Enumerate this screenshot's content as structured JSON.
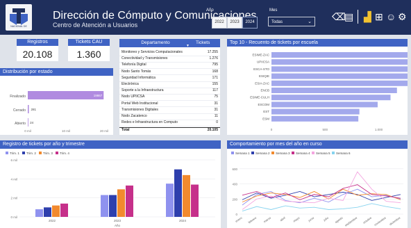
{
  "header": {
    "logo_text": "NACIONAL DE",
    "title": "Dirección de Cómputo y Comunicaciones",
    "subtitle": "Centro de Atención a Usuarios",
    "year_label": "Año",
    "years": [
      "2022",
      "2023",
      "2024"
    ],
    "selected_year": "2024",
    "month_label": "Mes",
    "month_value": "Todas",
    "icons": [
      "eraser-icon",
      "bookmark-icon",
      "bar-chart-icon",
      "sitemap-icon",
      "users-icon",
      "settings-icon"
    ]
  },
  "kpis": [
    {
      "label": "Registros",
      "value": "20.108"
    },
    {
      "label": "Tickets CAU",
      "value": "1.360"
    }
  ],
  "status_chart": {
    "title": "Distribución por estado",
    "categories": [
      "Finalizado",
      "Cerrado",
      "Abierto"
    ],
    "values": [
      19867,
      281,
      24
    ],
    "labels": [
      "19867",
      "281",
      "24"
    ],
    "x_ticks": [
      "0 mil",
      "10 mil",
      "20 mil"
    ],
    "color": "#b08be0"
  },
  "dept_table": {
    "col1": "Departamento",
    "col2": "Tickets",
    "rows": [
      [
        "Monitoreo y Servicios Computacionales",
        "17.255"
      ],
      [
        "Conectividad y Transmisiones",
        "1.276"
      ],
      [
        "Telefonía Digital",
        "795"
      ],
      [
        "Nodo Santo Tomás",
        "168"
      ],
      [
        "Seguridad Informática",
        "171"
      ],
      [
        "Electrónica",
        "155"
      ],
      [
        "Soporte a la Infraestructura",
        "117"
      ],
      [
        "Nodo UPIICSA",
        "75"
      ],
      [
        "Portal Web Institucional",
        "31"
      ],
      [
        "Transmisiones Digitales",
        "31"
      ],
      [
        "Nodo Zacatenco",
        "11"
      ],
      [
        "Redes e Infraestructura en Computo",
        "0"
      ]
    ],
    "total_label": "Total",
    "total_value": "20.105"
  },
  "top10": {
    "title": "Top 10 - Recuento de tickets por escuela",
    "categories": [
      "ESIME-ZAC",
      "UPIICSA",
      "ESCA-STO",
      "ESIQIE",
      "ESIA-ZAC",
      "ENCB",
      "ESIME-CULH",
      "ESCOM",
      "EST",
      "ESM"
    ],
    "values": [
      1600,
      1530,
      1510,
      1490,
      1400,
      1170,
      1110,
      990,
      820,
      810
    ],
    "x_ticks": [
      "0",
      "500",
      "1.000"
    ],
    "color": "#a3a9ec"
  },
  "year_quarter_chart": {
    "title": "Registro de tickets por año y trimestre",
    "legend": [
      "Trim. 1",
      "Trim. 2",
      "Trim. 3",
      "Trim. 4"
    ],
    "colors": [
      "#8f92ef",
      "#2e3fad",
      "#f28a2e",
      "#c6308a"
    ],
    "categories": [
      "2022",
      "2023",
      "2024"
    ],
    "series": [
      {
        "name": "Trim. 1",
        "values": [
          0.8,
          2.3,
          3.5
        ]
      },
      {
        "name": "Trim. 2",
        "values": [
          1.0,
          2.3,
          5.0
        ]
      },
      {
        "name": "Trim. 3",
        "values": [
          1.2,
          2.9,
          4.4
        ]
      },
      {
        "name": "Trim. 4",
        "values": [
          1.4,
          3.3,
          3.4
        ]
      }
    ],
    "y_ticks": [
      "0 mil",
      "2 mil",
      "4 mil",
      "6 mil"
    ],
    "ylim": [
      0,
      6
    ],
    "xlabel": "Año"
  },
  "monthly_chart": {
    "title": "Comportamiento por mes del año en curso",
    "legend": [
      "Semana 1",
      "Semana 2",
      "Semana 3",
      "Semana 4",
      "Semana 5",
      "Semana 6"
    ],
    "colors": [
      "#8f92ef",
      "#2e3fad",
      "#f28a2e",
      "#c6308a",
      "#f4a6e0",
      "#86d3ef"
    ],
    "months": [
      "enero",
      "febrero",
      "marzo",
      "abril",
      "mayo",
      "junio",
      "julio",
      "agosto",
      "septiembre",
      "octubre",
      "noviembre",
      "diciembre"
    ],
    "y_ticks": [
      "0",
      "200",
      "400",
      "600"
    ],
    "ylim": [
      0,
      700
    ],
    "series": [
      {
        "name": "Semana 1",
        "values": [
          120,
          260,
          300,
          180,
          150,
          210,
          160,
          260,
          330,
          230,
          250,
          200
        ]
      },
      {
        "name": "Semana 2",
        "values": [
          190,
          280,
          210,
          250,
          300,
          230,
          260,
          290,
          260,
          180,
          220,
          260
        ]
      },
      {
        "name": "Semana 3",
        "values": [
          160,
          240,
          280,
          260,
          220,
          300,
          200,
          330,
          250,
          270,
          260,
          190
        ]
      },
      {
        "name": "Semana 4",
        "values": [
          250,
          300,
          220,
          280,
          190,
          260,
          230,
          340,
          390,
          260,
          240,
          210
        ]
      },
      {
        "name": "Semana 5",
        "values": [
          60,
          200,
          240,
          170,
          160,
          150,
          210,
          180,
          560,
          330,
          170,
          150
        ]
      },
      {
        "name": "Semana 6",
        "values": [
          40,
          100,
          60,
          110,
          80,
          90,
          60,
          70,
          90,
          140,
          100,
          70
        ]
      }
    ]
  }
}
